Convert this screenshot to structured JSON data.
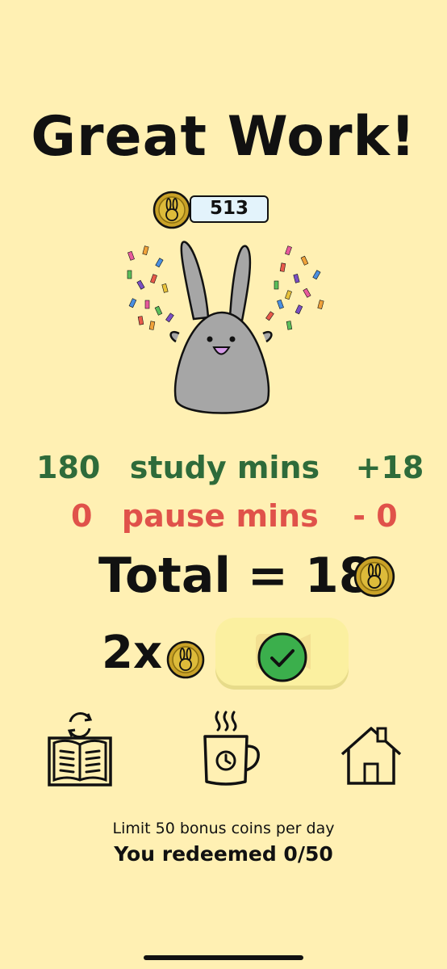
{
  "header": {
    "title": "Great Work!"
  },
  "balance": {
    "coins": "513"
  },
  "stats": {
    "study_minutes": "180",
    "study_label": "study mins",
    "study_bonus": "+18",
    "pause_minutes": "0",
    "pause_label": "pause mins",
    "pause_penalty": "- 0",
    "total_label": "Total =",
    "total_value": "18"
  },
  "multiplier": {
    "label": "2x"
  },
  "nav": {
    "items": [
      {
        "icon": "book-refresh-icon"
      },
      {
        "icon": "coffee-timer-icon"
      },
      {
        "icon": "home-icon"
      }
    ]
  },
  "footer": {
    "limit_text": "Limit 50 bonus coins per day",
    "redeemed_text": "You redeemed 0/50"
  },
  "colors": {
    "background": "#FFF0B3",
    "study_green": "#2E6B3A",
    "pause_red": "#E0524A",
    "coin_gold": "#C9A227",
    "balance_bg": "#E3F3FB",
    "check_green": "#3BAF4C"
  }
}
